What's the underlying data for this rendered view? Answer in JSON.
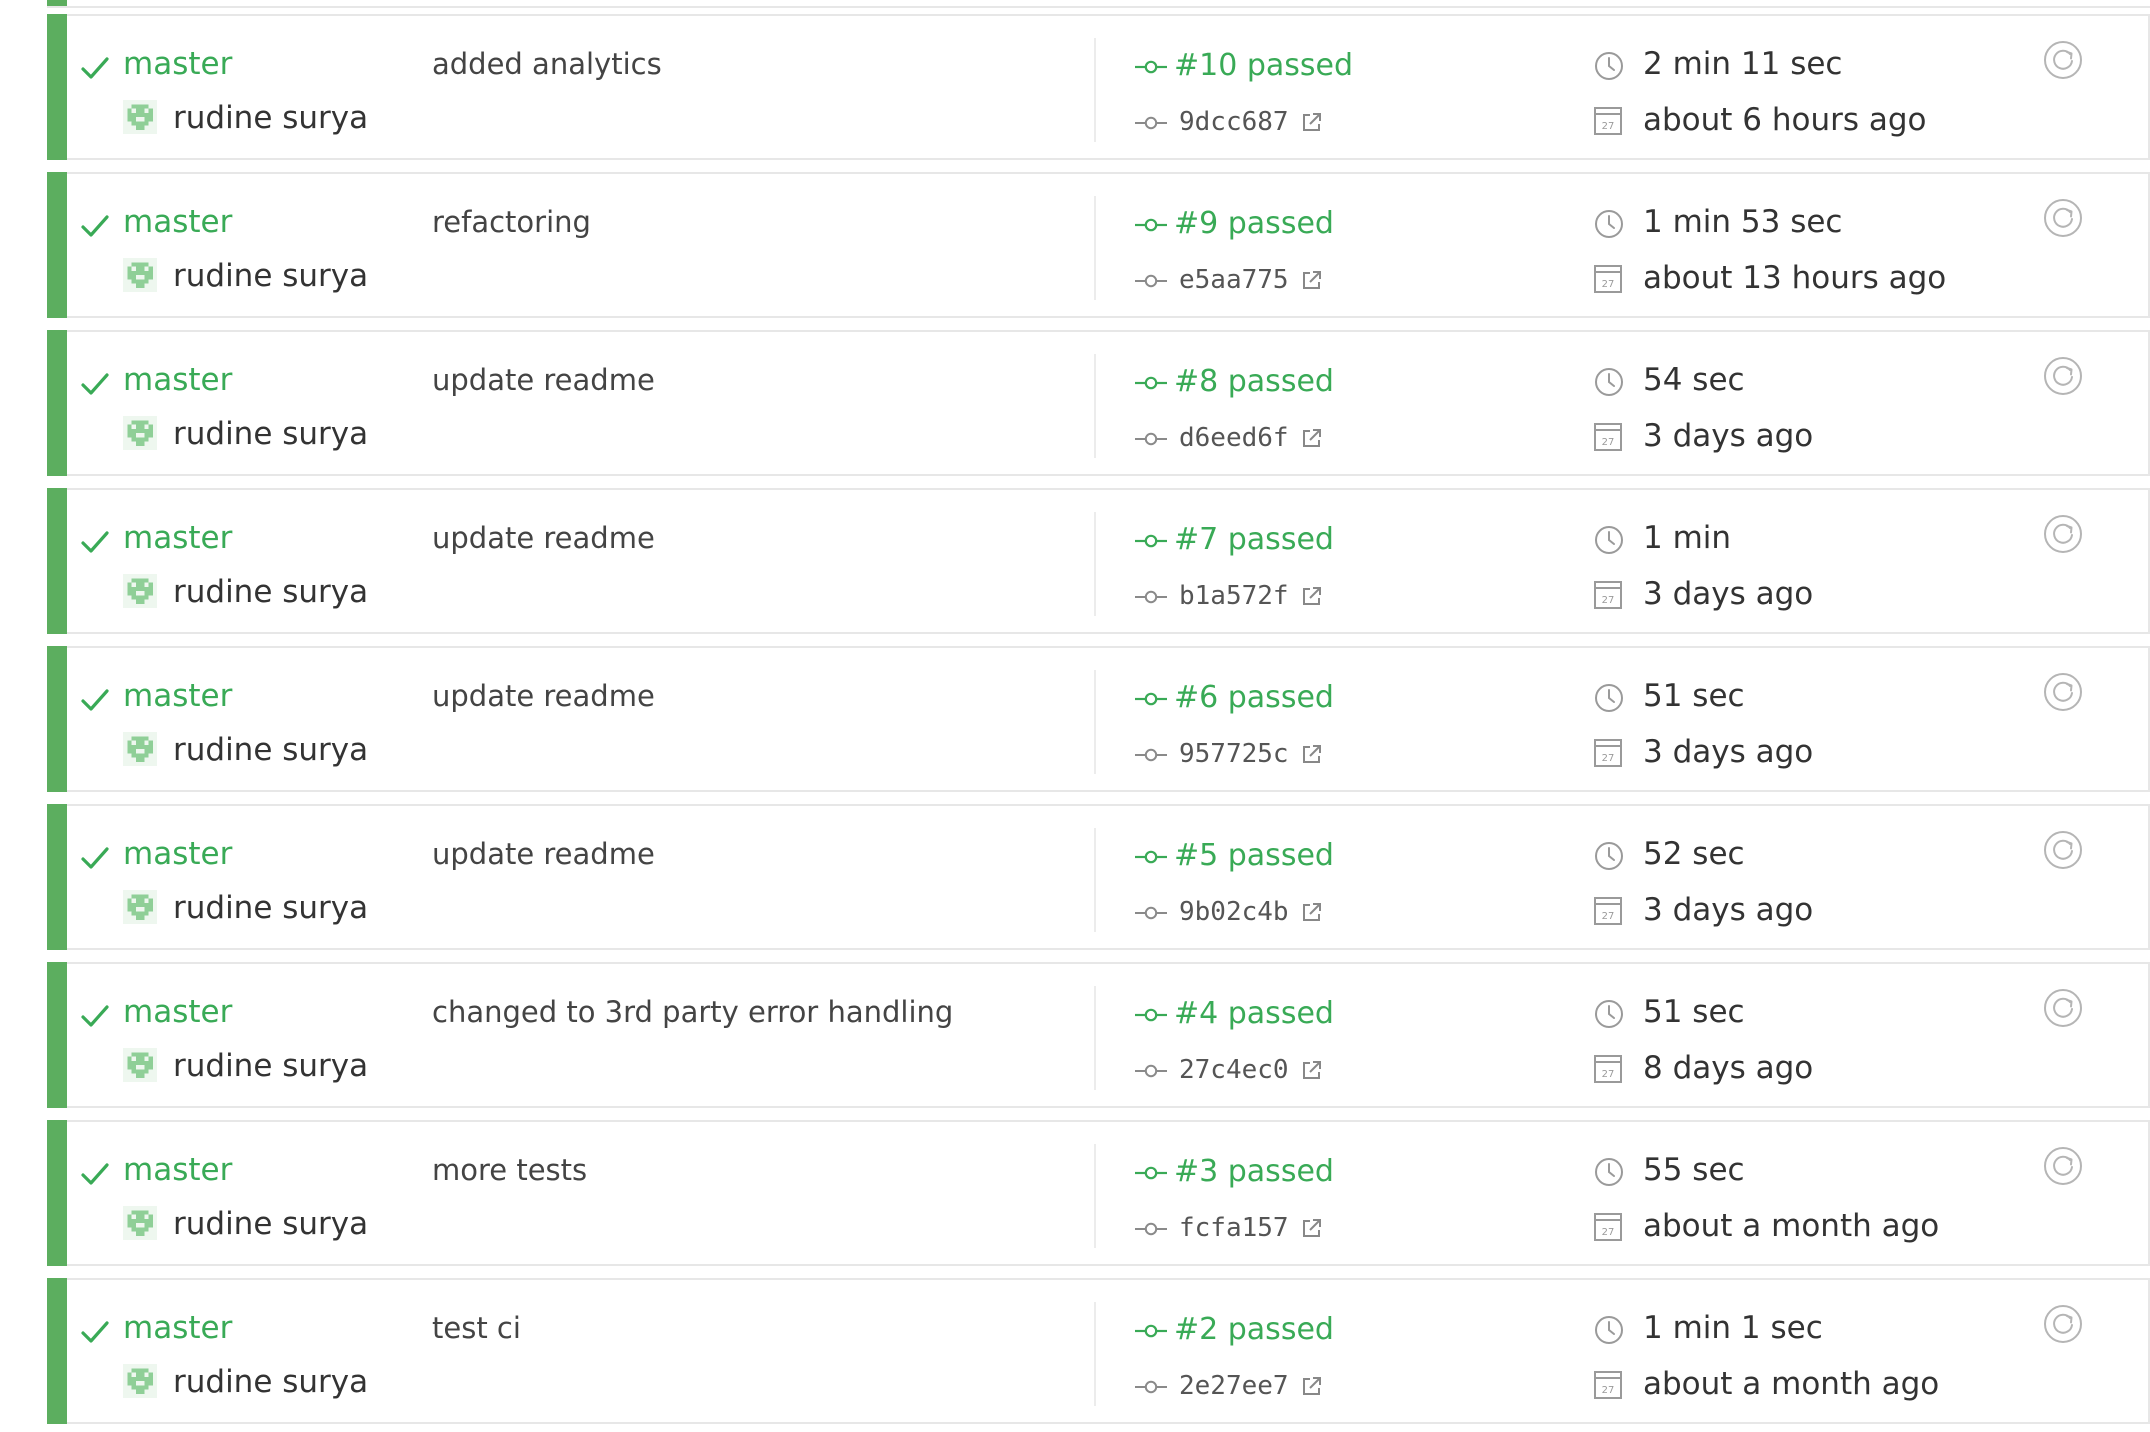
{
  "colors": {
    "passed": "#39aa56",
    "status_bar": "#5cae5f",
    "border": "#e7e7e7",
    "text": "#333333",
    "muted_icon": "#9a9a9a"
  },
  "icons": {
    "status": "check-icon",
    "author": "avatar",
    "build_number": "commit-icon",
    "commit_sha": "commit-icon",
    "external_link": "external-link-icon",
    "duration": "clock-icon",
    "finished": "calendar-icon",
    "restart": "restart-icon",
    "calendar_day": "27"
  },
  "builds": [
    {
      "branch": "master",
      "author": "rudine surya",
      "message": "added analytics",
      "build_number": "#10 passed",
      "commit_sha": "9dcc687",
      "duration": "2 min 11 sec",
      "finished": "about 6 hours ago"
    },
    {
      "branch": "master",
      "author": "rudine surya",
      "message": "refactoring",
      "build_number": "#9 passed",
      "commit_sha": "e5aa775",
      "duration": "1 min 53 sec",
      "finished": "about 13 hours ago"
    },
    {
      "branch": "master",
      "author": "rudine surya",
      "message": "update readme",
      "build_number": "#8 passed",
      "commit_sha": "d6eed6f",
      "duration": "54 sec",
      "finished": "3 days ago"
    },
    {
      "branch": "master",
      "author": "rudine surya",
      "message": "update readme",
      "build_number": "#7 passed",
      "commit_sha": "b1a572f",
      "duration": "1 min",
      "finished": "3 days ago"
    },
    {
      "branch": "master",
      "author": "rudine surya",
      "message": "update readme",
      "build_number": "#6 passed",
      "commit_sha": "957725c",
      "duration": "51 sec",
      "finished": "3 days ago"
    },
    {
      "branch": "master",
      "author": "rudine surya",
      "message": "update readme",
      "build_number": "#5 passed",
      "commit_sha": "9b02c4b",
      "duration": "52 sec",
      "finished": "3 days ago"
    },
    {
      "branch": "master",
      "author": "rudine surya",
      "message": "changed to 3rd party error handling",
      "build_number": "#4 passed",
      "commit_sha": "27c4ec0",
      "duration": "51 sec",
      "finished": "8 days ago"
    },
    {
      "branch": "master",
      "author": "rudine surya",
      "message": "more tests",
      "build_number": "#3 passed",
      "commit_sha": "fcfa157",
      "duration": "55 sec",
      "finished": "about a month ago"
    },
    {
      "branch": "master",
      "author": "rudine surya",
      "message": "test ci",
      "build_number": "#2 passed",
      "commit_sha": "2e27ee7",
      "duration": "1 min 1 sec",
      "finished": "about a month ago"
    }
  ]
}
